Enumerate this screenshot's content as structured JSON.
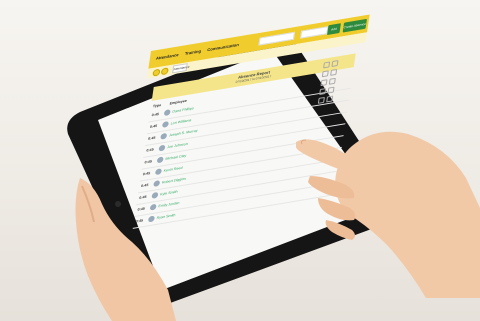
{
  "app": {
    "menu": [
      {
        "label": "Attendance"
      },
      {
        "label": "Training"
      },
      {
        "label": "Communication"
      }
    ],
    "add_label": "Add",
    "create_label": "Create Absence",
    "tab_label": "Attendance"
  },
  "report": {
    "title": "Absence Report",
    "date_range": "07/10/2017 to 07/10/2017"
  },
  "table": {
    "columns": [
      "Type",
      "Employee"
    ],
    "rows": [
      {
        "time": "0:45",
        "name": "Dana Phillips"
      },
      {
        "time": "0:45",
        "name": "Lori Williams"
      },
      {
        "time": "0:45",
        "name": "Joseph S. Murray"
      },
      {
        "time": "0:45",
        "name": "Joe Johnson"
      },
      {
        "time": "0:45",
        "name": "Michael Clay"
      },
      {
        "time": "0:45",
        "name": "Kevin Reed"
      },
      {
        "time": "0:45",
        "name": "Robert Diggins"
      },
      {
        "time": "0:45",
        "name": "Kyle Smith"
      },
      {
        "time": "0:45",
        "name": "Emily Jordan"
      },
      {
        "time": "0:45",
        "name": "Ryan Smith"
      }
    ]
  },
  "colors": {
    "header_yellow": "#f0cd2c",
    "report_yellow": "#f4e58a",
    "button_green": "#2e8b3d",
    "device_black": "#151515"
  }
}
